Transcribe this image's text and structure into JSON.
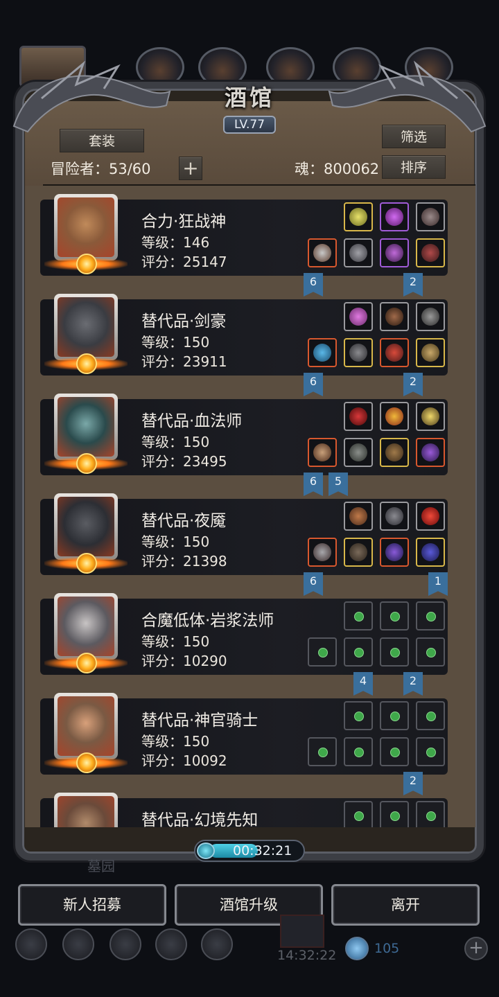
{
  "window": {
    "title": "酒馆",
    "level": "LV.77"
  },
  "header": {
    "set_label": "套装",
    "filter_label": "筛选",
    "sort_label": "排序",
    "plus_label": "+",
    "adventurer_text": "冒险者：53/60",
    "soul_text": "魂：800062"
  },
  "heroes": [
    {
      "name": "合力·狂战神",
      "level": "等级：146",
      "score": "评分：25147",
      "face": "#8a5a3a",
      "flags": [
        "6",
        "2"
      ]
    },
    {
      "name": "替代品·剑豪",
      "level": "等级：150",
      "score": "评分：23911",
      "face": "#3a3c42",
      "flags": [
        "6",
        "2"
      ]
    },
    {
      "name": "替代品·血法师",
      "level": "等级：150",
      "score": "评分：23495",
      "face": "#2a4a4c",
      "flags": [
        "6",
        "5"
      ]
    },
    {
      "name": "替代品·夜魇",
      "level": "等级：150",
      "score": "评分：21398",
      "face": "#2c2e34",
      "flags": [
        "6",
        "1"
      ]
    },
    {
      "name": "合魔低体·岩浆法师",
      "level": "等级：150",
      "score": "评分：10290",
      "face": "#5c5a60",
      "flags": [
        "4",
        "2"
      ]
    },
    {
      "name": "替代品·神官骑士",
      "level": "等级：150",
      "score": "评分：10092",
      "face": "#7a5a44",
      "flags": [
        "2"
      ]
    },
    {
      "name": "替代品·幻境先知",
      "level": "",
      "score": "",
      "face": "#6a4a3a",
      "flags": []
    }
  ],
  "timer": {
    "text": "00:32:21"
  },
  "background": {
    "faded_label": "墓园",
    "clock": "14:32:22",
    "coin_value": "105"
  },
  "footer": {
    "recruit_label": "新人招募",
    "upgrade_label": "酒馆升级",
    "leave_label": "离开"
  },
  "colors": {
    "panel_bg": "#5b4e40",
    "card_bg": "#15161b",
    "flag": "#3a6f9c",
    "accent_gold": "#d9b84a"
  }
}
